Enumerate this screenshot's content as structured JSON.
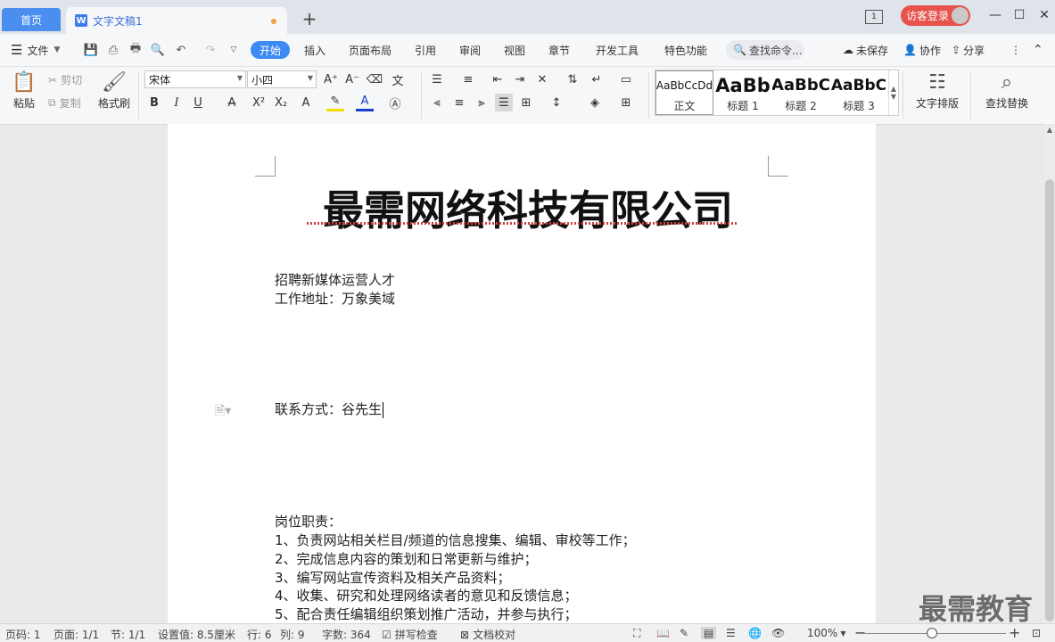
{
  "tabs": {
    "home": "首页",
    "document": "文字文稿1",
    "doc_icon": "W",
    "add": "+"
  },
  "window": {
    "page_count_icon": "1",
    "login": "访客登录",
    "minimize": "—",
    "maximize": "☐",
    "close": "✕"
  },
  "menu": {
    "file": "文件",
    "items": [
      "开始",
      "插入",
      "页面布局",
      "引用",
      "审阅",
      "视图",
      "章节",
      "开发工具",
      "特色功能"
    ],
    "search_cmd": "查找命令...",
    "unsaved": "未保存",
    "collab": "协作",
    "share": "分享"
  },
  "ribbon": {
    "paste": "粘贴",
    "cut": "剪切",
    "copy": "复制",
    "format_painter": "格式刷",
    "font_name": "宋体",
    "font_size": "小四",
    "styles": [
      {
        "preview": "AaBbCcDd",
        "label": "正文"
      },
      {
        "preview": "AaBb",
        "label": "标题 1"
      },
      {
        "preview": "AaBbC",
        "label": "标题 2"
      },
      {
        "preview": "AaBbC",
        "label": "标题 3"
      }
    ],
    "text_layout": "文字排版",
    "find_replace": "查找替换"
  },
  "document": {
    "title": "最需网络科技有限公司",
    "line1": "招聘新媒体运营人才",
    "line2": "工作地址：万象美域",
    "contact": "联系方式：谷先生",
    "duties_header": "岗位职责：",
    "duties": [
      "1、负责网站相关栏目/频道的信息搜集、编辑、审校等工作；",
      "2、完成信息内容的策划和日常更新与维护；",
      "3、编写网站宣传资料及相关产品资料；",
      "4、收集、研究和处理网络读者的意见和反馈信息；",
      "5、配合责任编辑组织策划推广活动，并参与执行；"
    ]
  },
  "watermark": "最需教育",
  "status": {
    "page": "页码: 1",
    "pages": "页面: 1/1",
    "section": "节: 1/1",
    "setting": "设置值: 8.5厘米",
    "row": "行: 6",
    "col": "列: 9",
    "words": "字数: 364",
    "spell": "拼写检查",
    "proof": "文档校对",
    "zoom": "100%",
    "zoom_fraction": 0.5
  }
}
